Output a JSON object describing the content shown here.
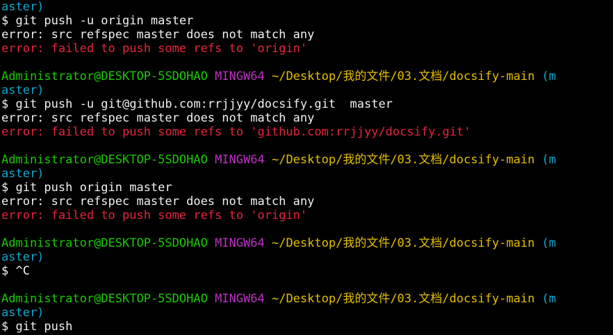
{
  "colors": {
    "background": "#000000",
    "text": "#f2f2f2",
    "error": "#e8243a",
    "user_host": "#19cb00",
    "mingw": "#c12fc8",
    "path": "#e5c000",
    "branch": "#11a8cd"
  },
  "lines": [
    {
      "segments": [
        {
          "text": "aster)",
          "color": "cyan"
        }
      ]
    },
    {
      "segments": [
        {
          "text": "$ git push -u origin master",
          "color": "white"
        }
      ]
    },
    {
      "segments": [
        {
          "text": "error: src refspec master does not match any",
          "color": "white"
        }
      ]
    },
    {
      "segments": [
        {
          "text": "error: failed to push some refs to 'origin'",
          "color": "red"
        }
      ]
    },
    {
      "segments": []
    },
    {
      "segments": [
        {
          "text": "Administrator@DESKTOP-5SDOHAO",
          "color": "green"
        },
        {
          "text": " ",
          "color": "white"
        },
        {
          "text": "MINGW64",
          "color": "magenta"
        },
        {
          "text": " ",
          "color": "white"
        },
        {
          "text": "~/Desktop/我的文件/03.文档/docsify-main",
          "color": "yellow"
        },
        {
          "text": " (m",
          "color": "cyan"
        }
      ]
    },
    {
      "segments": [
        {
          "text": "aster)",
          "color": "cyan"
        }
      ]
    },
    {
      "segments": [
        {
          "text": "$ git push -u git@github.com:rrjjyy/docsify.git  master",
          "color": "white"
        }
      ]
    },
    {
      "segments": [
        {
          "text": "error: src refspec master does not match any",
          "color": "white"
        }
      ]
    },
    {
      "segments": [
        {
          "text": "error: failed to push some refs to 'github.com:rrjjyy/docsify.git'",
          "color": "red"
        }
      ]
    },
    {
      "segments": []
    },
    {
      "segments": [
        {
          "text": "Administrator@DESKTOP-5SDOHAO",
          "color": "green"
        },
        {
          "text": " ",
          "color": "white"
        },
        {
          "text": "MINGW64",
          "color": "magenta"
        },
        {
          "text": " ",
          "color": "white"
        },
        {
          "text": "~/Desktop/我的文件/03.文档/docsify-main",
          "color": "yellow"
        },
        {
          "text": " (m",
          "color": "cyan"
        }
      ]
    },
    {
      "segments": [
        {
          "text": "aster)",
          "color": "cyan"
        }
      ]
    },
    {
      "segments": [
        {
          "text": "$ git push origin master",
          "color": "white"
        }
      ]
    },
    {
      "segments": [
        {
          "text": "error: src refspec master does not match any",
          "color": "white"
        }
      ]
    },
    {
      "segments": [
        {
          "text": "error: failed to push some refs to 'origin'",
          "color": "red"
        }
      ]
    },
    {
      "segments": []
    },
    {
      "segments": [
        {
          "text": "Administrator@DESKTOP-5SDOHAO",
          "color": "green"
        },
        {
          "text": " ",
          "color": "white"
        },
        {
          "text": "MINGW64",
          "color": "magenta"
        },
        {
          "text": " ",
          "color": "white"
        },
        {
          "text": "~/Desktop/我的文件/03.文档/docsify-main",
          "color": "yellow"
        },
        {
          "text": " (m",
          "color": "cyan"
        }
      ]
    },
    {
      "segments": [
        {
          "text": "aster)",
          "color": "cyan"
        }
      ]
    },
    {
      "segments": [
        {
          "text": "$ ^C",
          "color": "white"
        }
      ]
    },
    {
      "segments": []
    },
    {
      "segments": [
        {
          "text": "Administrator@DESKTOP-5SDOHAO",
          "color": "green"
        },
        {
          "text": " ",
          "color": "white"
        },
        {
          "text": "MINGW64",
          "color": "magenta"
        },
        {
          "text": " ",
          "color": "white"
        },
        {
          "text": "~/Desktop/我的文件/03.文档/docsify-main",
          "color": "yellow"
        },
        {
          "text": " (m",
          "color": "cyan"
        }
      ]
    },
    {
      "segments": [
        {
          "text": "aster)",
          "color": "cyan"
        }
      ]
    },
    {
      "segments": [
        {
          "text": "$ git push",
          "color": "white"
        }
      ]
    }
  ]
}
